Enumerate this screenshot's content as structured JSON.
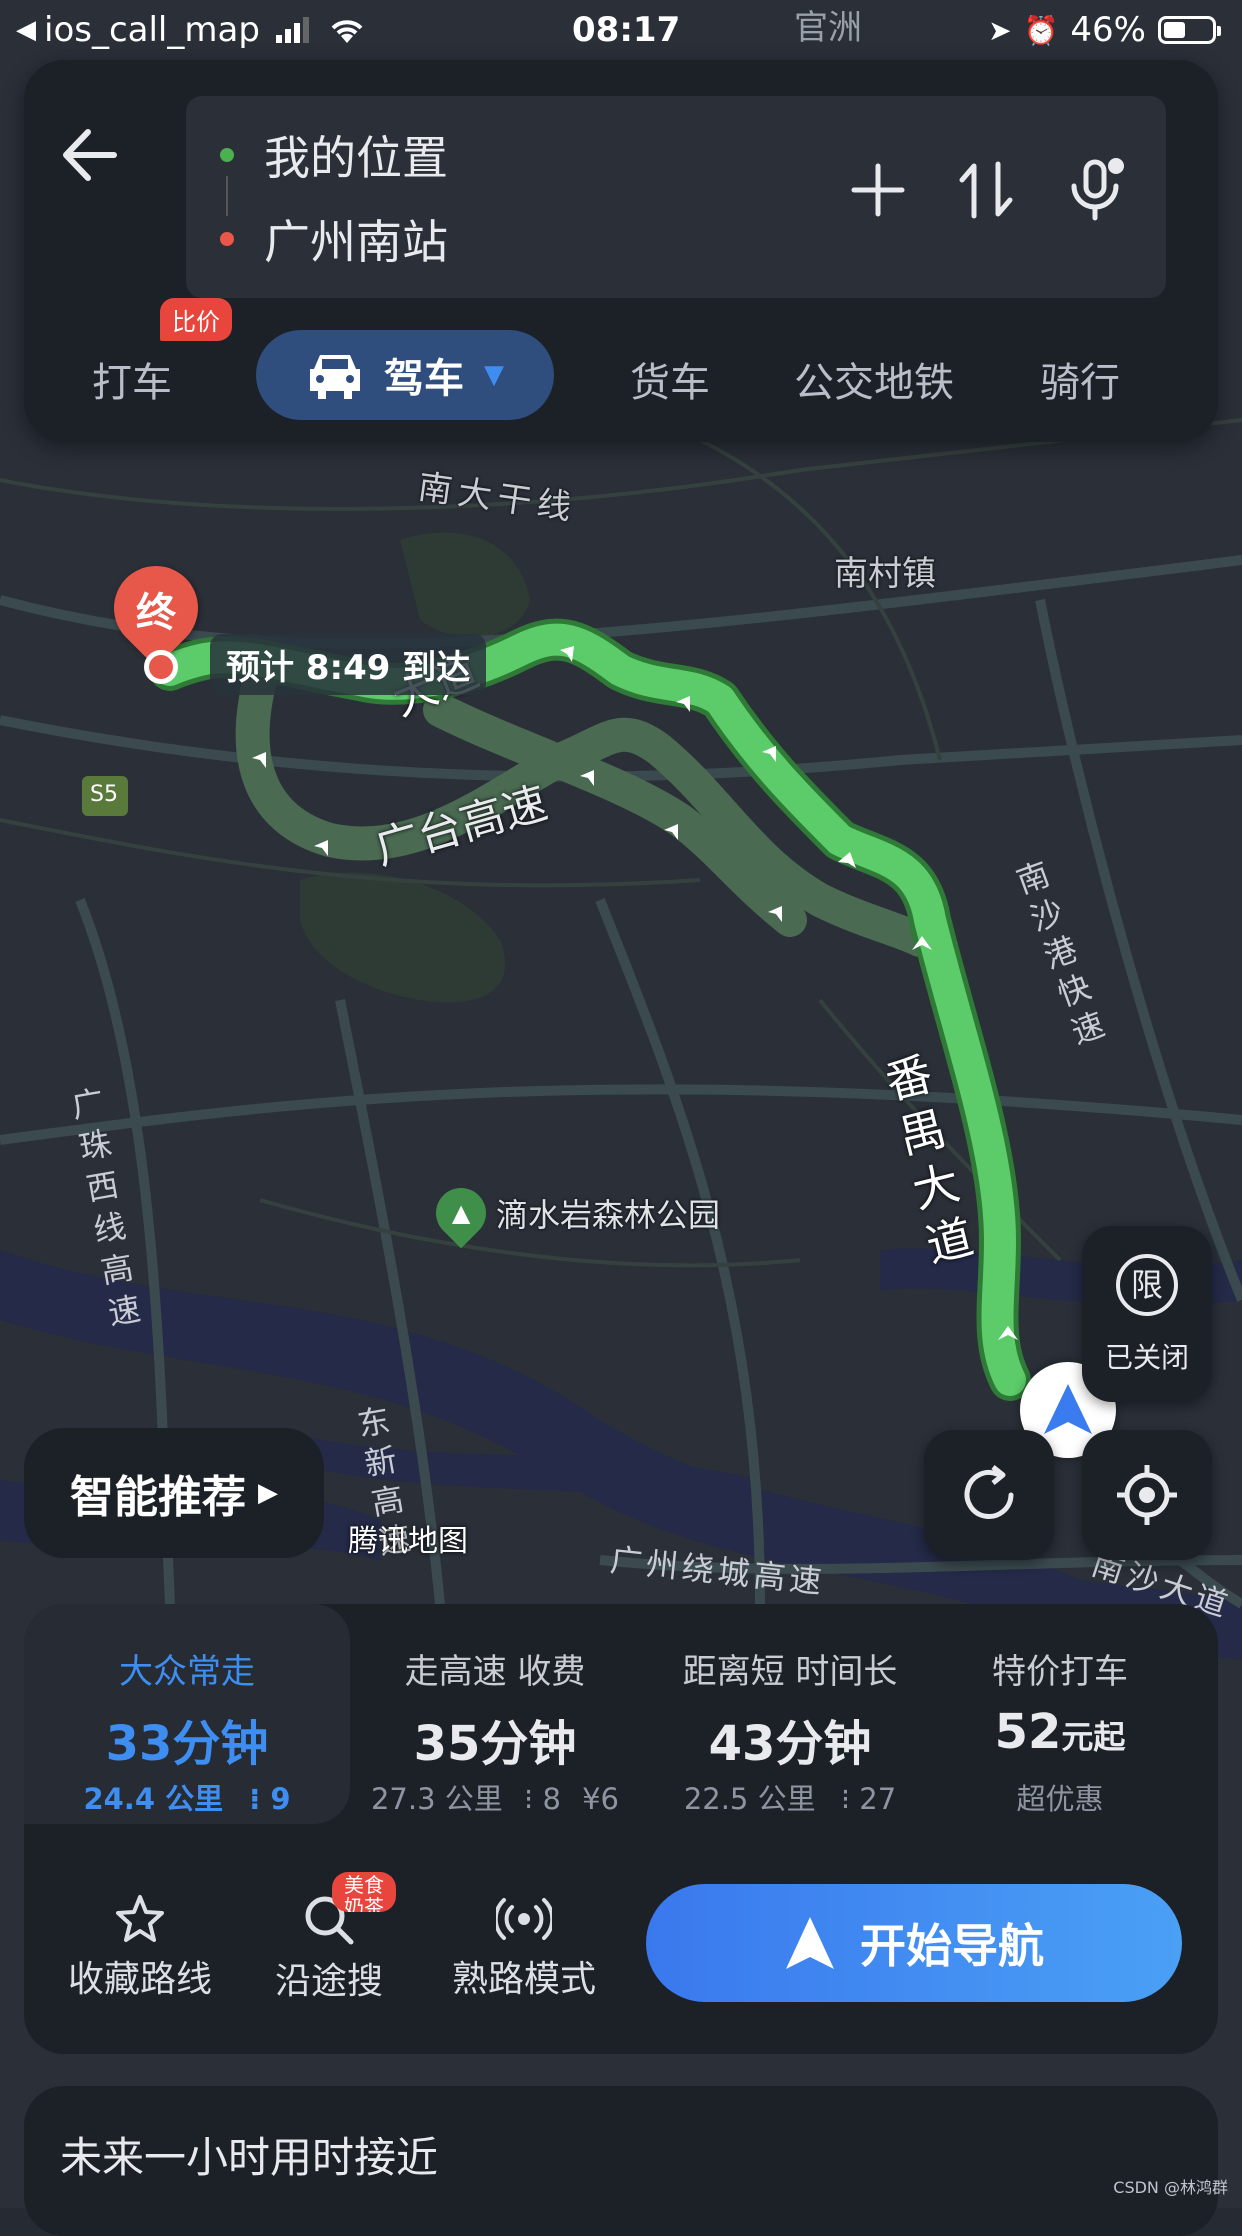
{
  "status_bar": {
    "back_app": "ios_call_map",
    "time": "08:17",
    "battery": "46%",
    "battery_level": 0.46
  },
  "route": {
    "origin": "我的位置",
    "destination": "广州南站",
    "origin_color": "#4caf50",
    "destination_color": "#e8584a"
  },
  "modes": {
    "taxi": "打车",
    "taxi_badge": "比价",
    "drive": "驾车",
    "truck": "货车",
    "transit": "公交地铁",
    "ride": "骑行"
  },
  "map": {
    "labels": {
      "nanda": "南大干线",
      "nancun": "南村镇",
      "guangtai": "广台高速",
      "panyu": "番禺大道",
      "nansha": "南沙港快速",
      "zhuxi": "广珠西线高速",
      "dishui": "滴水岩森林公园",
      "dongxin": "东新高速",
      "raocheng": "广州绕城高速",
      "nansha2": "南沙大道",
      "guanzhou": "官洲",
      "s5": "S5",
      "dadao": "大道"
    },
    "end_marker": "终",
    "eta_bubble": "预计 8:49 到达",
    "route_color": "#4cc45a",
    "alt_route_color": "#4b5a50"
  },
  "map_controls": {
    "limit_icon": "限",
    "limit_status": "已关闭",
    "smart_recommend": "智能推荐",
    "attribution": "腾讯地图"
  },
  "route_options": [
    {
      "label": "大众常走",
      "time": "33分钟",
      "distance": "24.4 公里",
      "lights": "9",
      "toll": ""
    },
    {
      "label": "走高速 收费",
      "time": "35分钟",
      "distance": "27.3 公里",
      "lights": "8",
      "toll": "¥6"
    },
    {
      "label": "距离短 时间长",
      "time": "43分钟",
      "distance": "22.5 公里",
      "lights": "27",
      "toll": ""
    },
    {
      "label": "特价打车",
      "price": "52",
      "price_unit": "元起",
      "sub": "超优惠"
    }
  ],
  "actions": {
    "favorite": "收藏路线",
    "along_search": "沿途搜",
    "along_badge": "美食奶茶",
    "familiar": "熟路模式",
    "start": "开始导航"
  },
  "future_hint": "未来一小时用时接近",
  "watermark": "CSDN @林鸿群",
  "colors": {
    "accent": "#3d8ef0",
    "panel": "#1c2027",
    "badge_red": "#e8453c"
  }
}
